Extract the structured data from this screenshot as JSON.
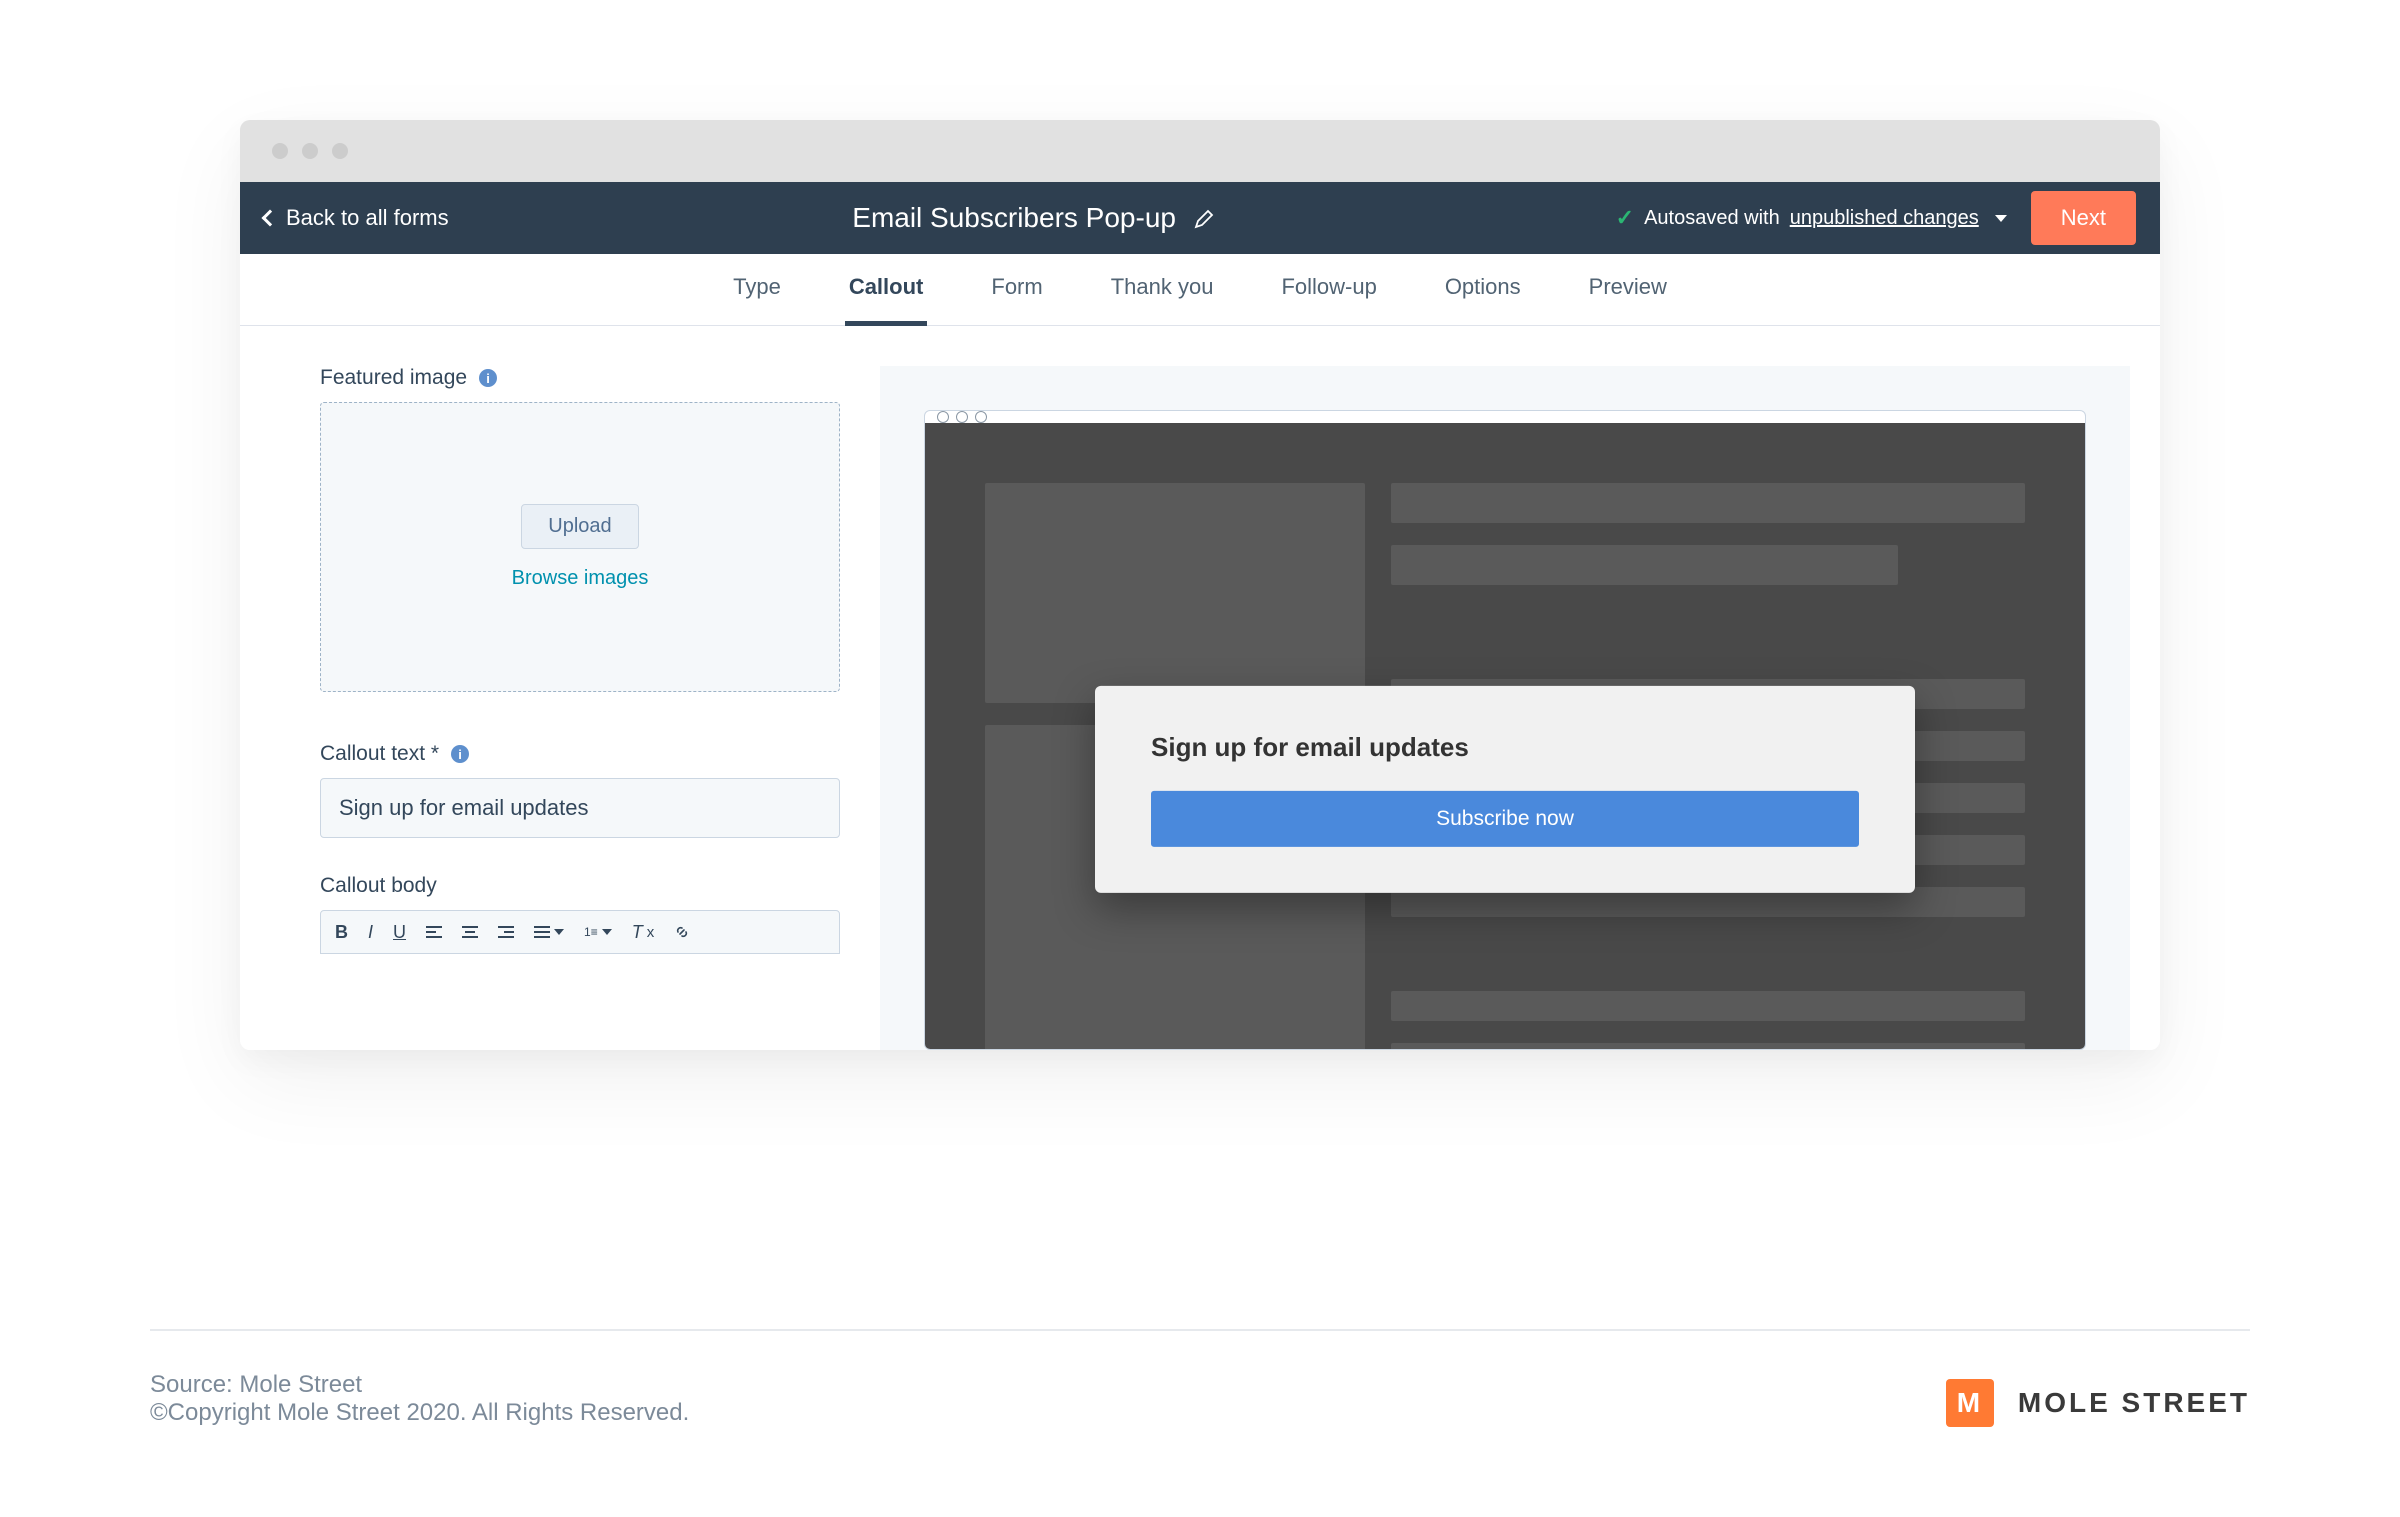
{
  "header": {
    "back_label": "Back to all forms",
    "title": "Email Subscribers Pop-up",
    "autosave_prefix": "Autosaved with",
    "autosave_link": "unpublished changes",
    "next_label": "Next"
  },
  "tabs": [
    {
      "label": "Type"
    },
    {
      "label": "Callout",
      "active": true
    },
    {
      "label": "Form"
    },
    {
      "label": "Thank you"
    },
    {
      "label": "Follow-up"
    },
    {
      "label": "Options"
    },
    {
      "label": "Preview"
    }
  ],
  "form": {
    "featured_image_label": "Featured image",
    "upload_label": "Upload",
    "browse_label": "Browse images",
    "callout_text_label": "Callout text *",
    "callout_text_value": "Sign up for email updates",
    "callout_body_label": "Callout body"
  },
  "preview": {
    "popup_title": "Sign up for email updates",
    "popup_button": "Subscribe now"
  },
  "footer": {
    "source": "Source: Mole Street",
    "copyright": "©Copyright Mole Street 2020. All Rights Reserved.",
    "brand": "MOLE STREET"
  }
}
